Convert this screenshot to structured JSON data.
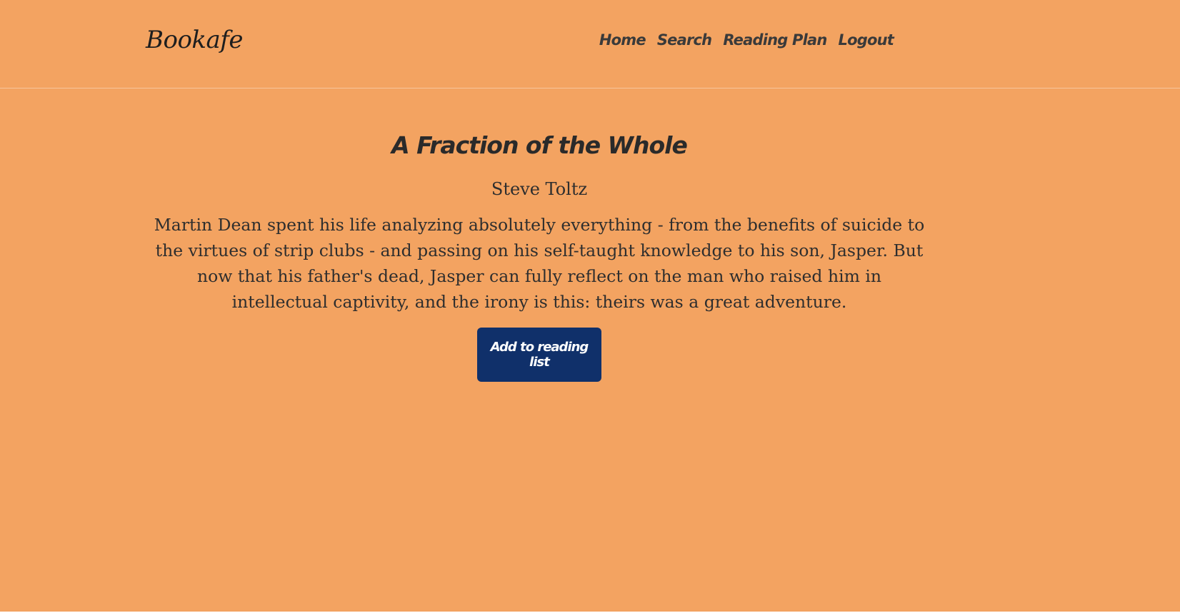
{
  "header": {
    "brand": "Bookafe",
    "nav": [
      {
        "label": "Home"
      },
      {
        "label": "Search"
      },
      {
        "label": "Reading Plan"
      },
      {
        "label": "Logout"
      }
    ]
  },
  "book": {
    "title": "A Fraction of the Whole",
    "author": "Steve Toltz",
    "description": "Martin Dean spent his life analyzing absolutely everything - from the benefits of suicide to the virtues of strip clubs - and passing on his self-taught knowledge to his son, Jasper. But now that his father's dead, Jasper can fully reflect on the man who raised him in intellectual captivity, and the irony is this: theirs was a great adventure."
  },
  "actions": {
    "add_label": "Add to reading list"
  },
  "colors": {
    "background": "#f3a361",
    "button": "#10306a",
    "text": "#2b2b2b"
  }
}
